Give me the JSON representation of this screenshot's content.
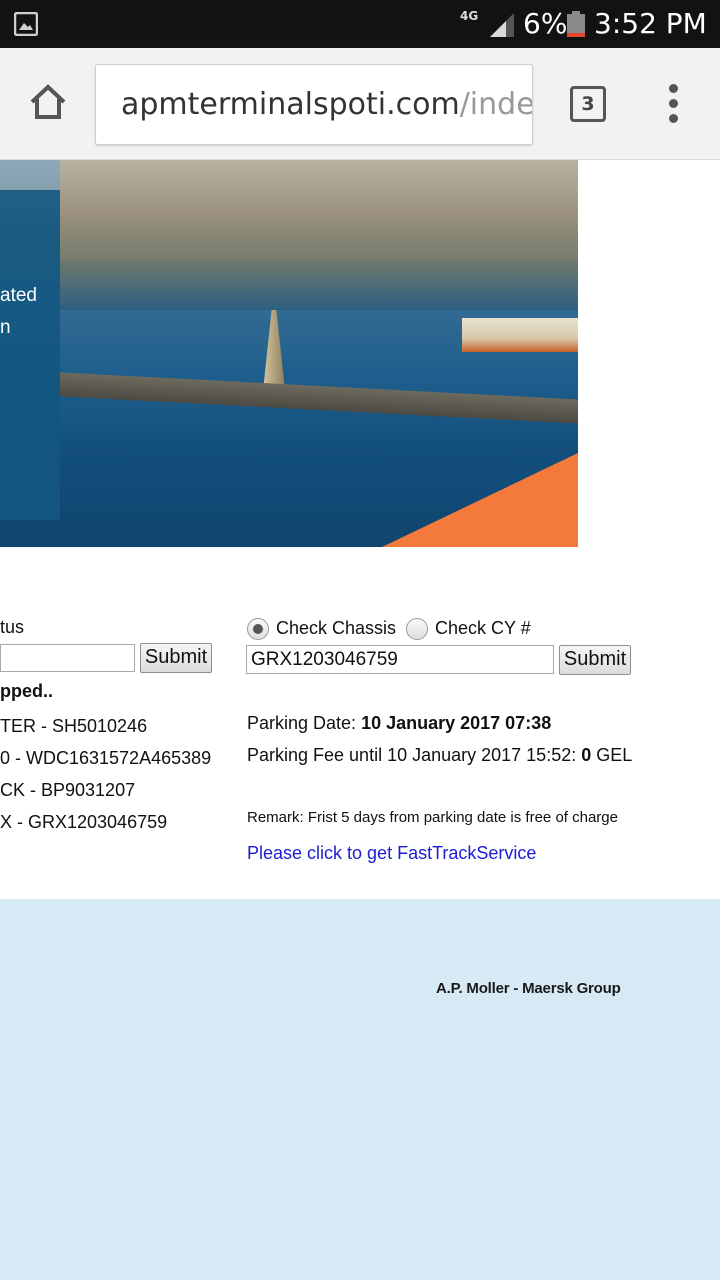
{
  "status_bar": {
    "network": "4G",
    "battery_percent": "6%",
    "time": "3:52 PM"
  },
  "browser": {
    "url_host": "apmterminalspoti.com",
    "url_path": "/inde",
    "tab_count": "3"
  },
  "hero": {
    "panel_lines": [
      "ated",
      "n"
    ]
  },
  "left_form": {
    "status_label": "tus",
    "input_value": "",
    "submit_label": "Submit",
    "stopped_text": "pped..",
    "items": [
      "TER - SH5010246",
      "0 - WDC1631572A465389",
      "CK - BP9031207",
      "X - GRX1203046759"
    ]
  },
  "right_form": {
    "radio_chassis_label": "Check Chassis",
    "radio_cy_label": "Check CY #",
    "input_value": "GRX1203046759",
    "submit_label": "Submit",
    "parking_date_label": "Parking Date: ",
    "parking_date_value": "10 January 2017 07:38",
    "parking_fee_label": "Parking Fee until 10 January 2017 15:52: ",
    "parking_fee_value": "0",
    "parking_fee_currency": " GEL",
    "remark": "Remark: Frist 5 days from parking date is free of charge",
    "fasttrack_link": "Please click to get FastTrackService"
  },
  "footer": {
    "brand": "A.P. Moller - Maersk Group"
  }
}
